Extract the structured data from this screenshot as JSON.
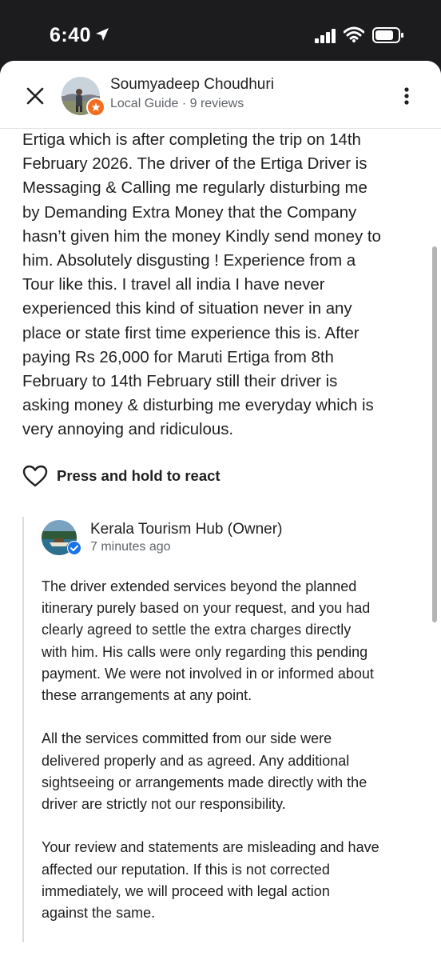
{
  "status_bar": {
    "time": "6:40"
  },
  "header": {
    "reviewer_name": "Soumyadeep Choudhuri",
    "reviewer_meta": "Local Guide · 9 reviews"
  },
  "review": {
    "lines": [
      "Ertiga which is after completing the trip on 14th",
      "February 2026. The driver of the Ertiga Driver is",
      "Messaging & Calling me regularly disturbing me",
      "by Demanding Extra Money that the Company",
      "hasn’t given him the money Kindly send money to",
      "him. Absolutely disgusting ! Experience from a",
      "Tour like this. I travel all india I have never",
      "experienced this kind of situation never in any",
      "place or state first time experience this is. After",
      "paying Rs 26,000 for Maruti Ertiga from 8th",
      "February to 14th February still their driver is",
      "asking money & disturbing me everyday which is",
      "very annoying and ridiculous."
    ]
  },
  "react": {
    "label": "Press and hold to react"
  },
  "owner_reply": {
    "name": "Kerala Tourism Hub (Owner)",
    "time": "7 minutes ago",
    "para1": [
      "The driver extended services beyond the planned",
      "itinerary purely based on your request, and you had",
      "clearly agreed to settle the extra charges directly",
      "with him. His calls were only regarding this pending",
      "payment. We were not involved in or informed about",
      "these arrangements at any point."
    ],
    "para2": [
      "All the services committed from our side were",
      "delivered properly and as agreed. Any additional",
      "sightseeing or arrangements made directly with the",
      "driver are strictly not our responsibility."
    ],
    "para3": [
      "Your review and statements are misleading and have",
      "affected our reputation. If this is not corrected",
      "immediately, we will proceed with legal action",
      "against the same."
    ]
  },
  "icons": {
    "close": "close-icon",
    "more": "more-vertical-icon",
    "heart": "heart-outline-icon",
    "location": "location-arrow-icon",
    "local_guide": "local-guide-badge-icon",
    "verified": "verified-check-icon"
  },
  "colors": {
    "local_guide_badge": "#f36d21",
    "verified_badge": "#1a73e8",
    "text_primary": "#1f1f1f",
    "text_secondary": "#5f6368"
  }
}
